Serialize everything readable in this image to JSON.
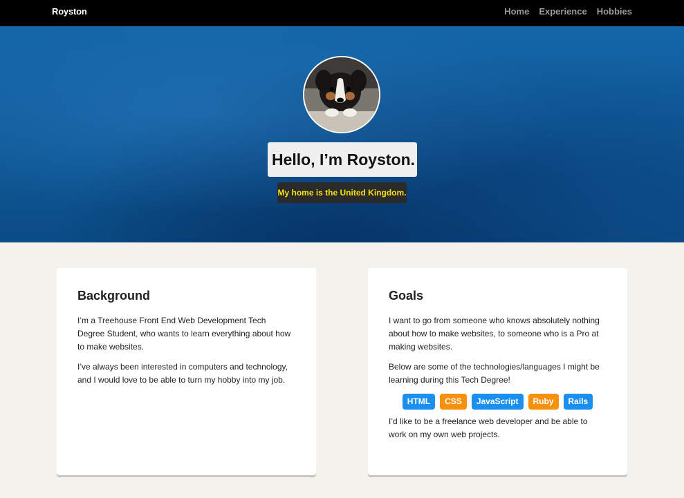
{
  "nav": {
    "brand": "Royston",
    "links": [
      {
        "label": "Home"
      },
      {
        "label": "Experience"
      },
      {
        "label": "Hobbies"
      }
    ]
  },
  "hero": {
    "avatar_icon": "puppy-photo",
    "title": "Hello, I’m Royston.",
    "tagline": "My home is the United Kingdom."
  },
  "background": {
    "heading": "Background",
    "paragraphs": [
      "I’m a Treehouse Front End Web Development Tech Degree Student, who wants to learn everything about how to make websites.",
      "I’ve always been interested in computers and technology, and I would love to be able to turn my hobby into my job."
    ]
  },
  "goals": {
    "heading": "Goals",
    "paragraphs": [
      "I want to go from someone who knows absolutely nothing about how to make websites, to someone who is a Pro at making websites.",
      "Below are some of the technologies/languages I might be learning during this Tech Degree!",
      "I’d like to be a freelance web developer and be able to work on my own web projects."
    ],
    "tags": [
      {
        "label": "HTML",
        "color": "#1a8ff0"
      },
      {
        "label": "CSS",
        "color": "#f7910d"
      },
      {
        "label": "JavaScript",
        "color": "#1a8ff0"
      },
      {
        "label": "Ruby",
        "color": "#f7910d"
      },
      {
        "label": "Rails",
        "color": "#1a8ff0"
      }
    ]
  },
  "colors": {
    "nav_bg": "#000000",
    "hero_blue": "#1466a8",
    "tagline_text": "#f5e214",
    "page_bg": "#f4f2ed"
  }
}
